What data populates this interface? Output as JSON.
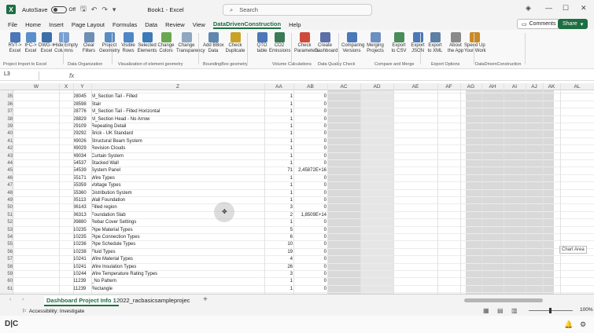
{
  "titlebar": {
    "autosave": "AutoSave",
    "autosave_state": "Off",
    "book": "Book1 - Excel",
    "search_placeholder": "Search"
  },
  "menu": [
    "File",
    "Home",
    "Insert",
    "Page Layout",
    "Formulas",
    "Data",
    "Review",
    "View",
    "DataDrivenConstruction",
    "Help"
  ],
  "menu_active": "DataDrivenConstruction",
  "comments_label": "Comments",
  "share_label": "Share",
  "ribbon": {
    "buttons": [
      {
        "label": "RVT->\nExcel",
        "color": "#4a78b8"
      },
      {
        "label": "IFC->\nExcel",
        "color": "#5b8fc9"
      },
      {
        "label": "DWG->\nExcel",
        "color": "#3c6fa8"
      },
      {
        "label": "Hide Empty\nColumns",
        "color": "#7aa0d1"
      },
      {
        "label": "Clear\nFilters",
        "color": "#6d8fb5"
      },
      {
        "label": "Project\nGeometry",
        "color": "#5a8cc4"
      },
      {
        "label": "Visible\nRows",
        "color": "#4f86c6"
      },
      {
        "label": "Selected\nElements",
        "color": "#3d7ab8"
      },
      {
        "label": "Change\nColors",
        "color": "#6aa84f"
      },
      {
        "label": "Change\nTransparency",
        "color": "#8fa7c0"
      },
      {
        "label": "Add BBox\nData",
        "color": "#5f87b0"
      },
      {
        "label": "Check\nDuplicate",
        "color": "#c9a227"
      },
      {
        "label": "QTO\ntable",
        "color": "#4a78b8"
      },
      {
        "label": "CO2\nEmissions",
        "color": "#3b7a57"
      },
      {
        "label": "Check\nParameters",
        "color": "#d04a3c"
      },
      {
        "label": "Create\nDashboard",
        "color": "#5b6fa8"
      },
      {
        "label": "Comparing\nVersions",
        "color": "#4a78b8"
      },
      {
        "label": "Merging\nProjects",
        "color": "#6a8fc0"
      },
      {
        "label": "Export\nto CSV",
        "color": "#4a8c5a"
      },
      {
        "label": "Export\nJSON",
        "color": "#4a78b8"
      },
      {
        "label": "Export\nto XML",
        "color": "#5e7fa6"
      },
      {
        "label": "About\nthe App",
        "color": "#8a8a8a"
      },
      {
        "label": "Speed Up\nYour Work",
        "color": "#c98a27"
      }
    ],
    "groups": [
      "Project Import to Excel",
      "Data Organization",
      "Visualization of element geometry",
      "BoundingBox geometry",
      "Volume Calculations",
      "Data Quality Check",
      "Compare and Merge",
      "Export Options",
      "DataDrivenConstruction"
    ]
  },
  "formula_bar": {
    "cell": "L3",
    "fx": "fx"
  },
  "columns": [
    "W",
    "X",
    "Y",
    "Z",
    "AA",
    "AB",
    "AC",
    "AD",
    "AE",
    "AF",
    "AG",
    "AH",
    "AI",
    "AJ",
    "AK",
    "AL"
  ],
  "rows": [
    {
      "n": "34",
      "id": "",
      "name": "",
      "aa": "",
      "ab": ""
    },
    {
      "n": "35",
      "id": "28045",
      "name": "M_Section Tail - Filled",
      "aa": "1",
      "ab": "0"
    },
    {
      "n": "36",
      "id": "28598",
      "name": "Stair",
      "aa": "1",
      "ab": "0"
    },
    {
      "n": "37",
      "id": "28776",
      "name": "M_Section Tail - Filled Horizontal",
      "aa": "1",
      "ab": "0"
    },
    {
      "n": "38",
      "id": "28829",
      "name": "M_Section Head - No Arrow",
      "aa": "1",
      "ab": "0"
    },
    {
      "n": "39",
      "id": "29109",
      "name": "Repeating Detail",
      "aa": "1",
      "ab": "0"
    },
    {
      "n": "40",
      "id": "29292",
      "name": "Brick - UK Standard",
      "aa": "1",
      "ab": "0"
    },
    {
      "n": "41",
      "id": "49026",
      "name": "Structural Beam System",
      "aa": "1",
      "ab": "0"
    },
    {
      "n": "42",
      "id": "49029",
      "name": "Revision Clouds",
      "aa": "1",
      "ab": "0"
    },
    {
      "n": "43",
      "id": "49034",
      "name": "Curtain System",
      "aa": "1",
      "ab": "0"
    },
    {
      "n": "44",
      "id": "54537",
      "name": "Stacked Wall",
      "aa": "1",
      "ab": "0"
    },
    {
      "n": "45",
      "id": "54539",
      "name": "System Panel",
      "aa": "71",
      "ab": "2,45872E+16"
    },
    {
      "n": "46",
      "id": "55171",
      "name": "Wire Types",
      "aa": "1",
      "ab": "0"
    },
    {
      "n": "47",
      "id": "55359",
      "name": "Voltage Types",
      "aa": "1",
      "ab": "0"
    },
    {
      "n": "48",
      "id": "55360",
      "name": "Distribution System",
      "aa": "1",
      "ab": "0"
    },
    {
      "n": "49",
      "id": "85113",
      "name": "Wall Foundation",
      "aa": "1",
      "ab": "0"
    },
    {
      "n": "50",
      "id": "86143",
      "name": "Filled region",
      "aa": "3",
      "ab": "0"
    },
    {
      "n": "51",
      "id": "86313",
      "name": "Foundation Slab",
      "aa": "2",
      "ab": "1,8509E+14"
    },
    {
      "n": "52",
      "id": "99880",
      "name": "Rebar Cover Settings",
      "aa": "1",
      "ab": "0"
    },
    {
      "n": "53",
      "id": "10235",
      "name": "Pipe Material Types",
      "aa": "5",
      "ab": "0"
    },
    {
      "n": "54",
      "id": "10235",
      "name": "Pipe Connection Types",
      "aa": "6",
      "ab": "0"
    },
    {
      "n": "55",
      "id": "10236",
      "name": "Pipe Schedule Types",
      "aa": "10",
      "ab": "0"
    },
    {
      "n": "56",
      "id": "10238",
      "name": "Fluid Types",
      "aa": "19",
      "ab": "0"
    },
    {
      "n": "57",
      "id": "10241",
      "name": "Wire Material Types",
      "aa": "4",
      "ab": "0"
    },
    {
      "n": "58",
      "id": "10241",
      "name": "Wire Insulation Types",
      "aa": "26",
      "ab": "0"
    },
    {
      "n": "59",
      "id": "10244",
      "name": "Wire Temperature Rating Types",
      "aa": "3",
      "ab": "0"
    },
    {
      "n": "60",
      "id": "11239",
      "name": "_No Pattern",
      "aa": "1",
      "ab": "0"
    },
    {
      "n": "61",
      "id": "11239",
      "name": "Rectangle",
      "aa": "1",
      "ab": "0"
    }
  ],
  "chart_area_label": "Chart Area",
  "sheet_tabs": [
    "Dashboard Project Info 1",
    "2022_racbasicsampleprojec"
  ],
  "status": {
    "accessibility": "Accessibility: Investigate",
    "zoom": "100%"
  },
  "colors": {
    "excel_green": "#1d6f42",
    "grid_shade": "#d9d9d9"
  }
}
